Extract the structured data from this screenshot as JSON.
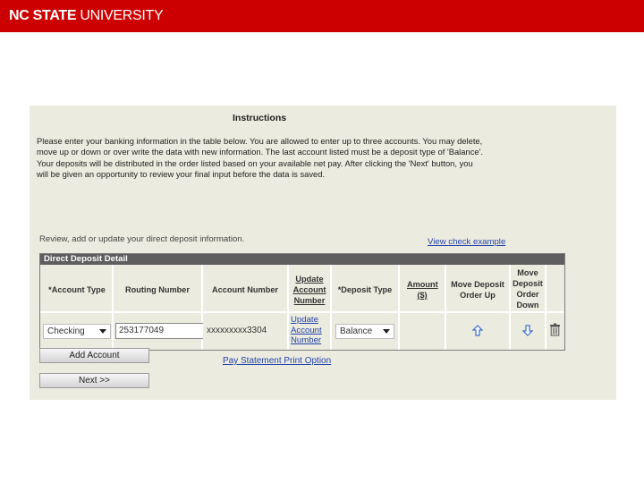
{
  "header": {
    "brand_bold": "NC STATE",
    "brand_rest": " UNIVERSITY",
    "bar_color": "#cc0000"
  },
  "instructions": {
    "title": "Instructions",
    "body": "Please enter your banking information in the table below. You are allowed to enter up to three accounts. You may delete, move up or down or over write the data with new information. The last account listed must be a deposit type of 'Balance'. Your deposits will be distributed in the order listed based on your available net pay. After clicking the 'Next' button, you will be given an opportunity to review your final input before the data is saved."
  },
  "review_text": "Review, add or update your direct deposit information.",
  "view_check_link": "View check example",
  "table": {
    "title": "Direct Deposit Detail",
    "headers": {
      "account_type": "*Account Type",
      "routing_number": "Routing Number",
      "account_number": "Account Number",
      "update_account_number": "Update Account Number",
      "deposit_type": "*Deposit Type",
      "amount": "Amount ($)",
      "move_up": "Move Deposit Order Up",
      "move_down": "Move Deposit Order Down"
    },
    "rows": [
      {
        "account_type": "Checking",
        "routing_number": "253177049",
        "account_number": "xxxxxxxxx3304",
        "update_link": "Update Account Number",
        "deposit_type": "Balance",
        "amount": ""
      }
    ]
  },
  "buttons": {
    "add_account": "Add Account",
    "next": "Next >>"
  },
  "pay_statement_link": "Pay Statement Print Option",
  "icons": {
    "move_up": "up-arrow-icon",
    "move_down": "down-arrow-icon",
    "delete": "trash-icon"
  }
}
